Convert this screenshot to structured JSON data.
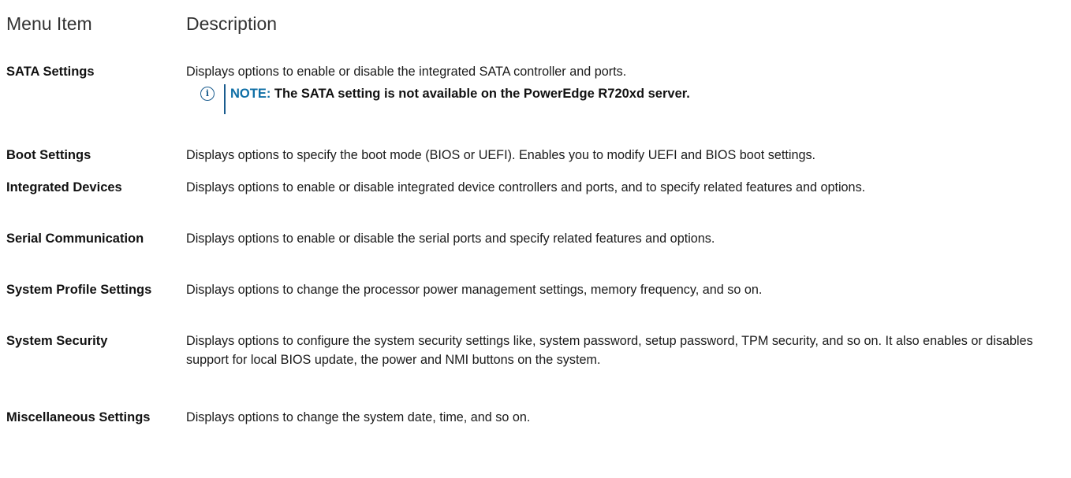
{
  "header": {
    "col1": "Menu Item",
    "col2": "Description"
  },
  "rows": [
    {
      "name": "SATA Settings",
      "description": "Displays options to enable or disable the integrated SATA controller and ports."
    },
    {
      "name": "Boot Settings",
      "description": "Displays options to specify the boot mode (BIOS or UEFI). Enables you to modify UEFI and BIOS boot settings."
    },
    {
      "name": "Integrated Devices",
      "description": "Displays options to enable or disable integrated device controllers and ports, and to specify related features and options."
    },
    {
      "name": "Serial Communication",
      "description": "Displays options to enable or disable the serial ports and specify related features and options."
    },
    {
      "name": "System Profile Settings",
      "description": "Displays options to change the processor power management settings, memory frequency, and so on."
    },
    {
      "name": "System Security",
      "description": "Displays options to configure the system security settings like, system password, setup password, TPM security, and so on. It also enables or disables support for local BIOS update, the power and NMI buttons on the system."
    },
    {
      "name": "Miscellaneous Settings",
      "description": "Displays options to change the system date, time, and so on."
    }
  ],
  "note": {
    "label": "NOTE:",
    "text": " The SATA setting is not available on the PowerEdge R720xd server.",
    "icon": "info-icon",
    "color": "#0f6fa6"
  }
}
